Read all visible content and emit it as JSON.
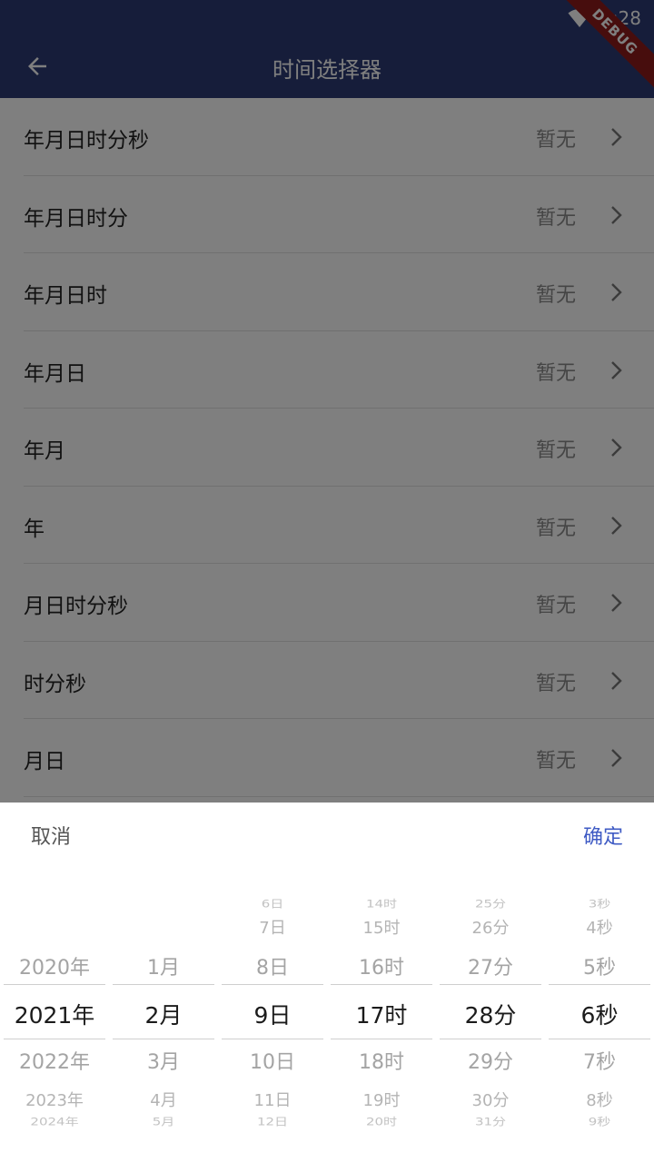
{
  "status_bar": {
    "time": "5:28",
    "debug_label": "DEBUG"
  },
  "app_bar": {
    "title": "时间选择器"
  },
  "list": {
    "items": [
      {
        "label": "年月日时分秒",
        "value": "暂无"
      },
      {
        "label": "年月日时分",
        "value": "暂无"
      },
      {
        "label": "年月日时",
        "value": "暂无"
      },
      {
        "label": "年月日",
        "value": "暂无"
      },
      {
        "label": "年月",
        "value": "暂无"
      },
      {
        "label": "年",
        "value": "暂无"
      },
      {
        "label": "月日时分秒",
        "value": "暂无"
      },
      {
        "label": "时分秒",
        "value": "暂无"
      },
      {
        "label": "月日",
        "value": "暂无"
      }
    ]
  },
  "picker": {
    "cancel_label": "取消",
    "confirm_label": "确定",
    "accent_color": "#3f5bc4",
    "columns": [
      {
        "name": "year",
        "items": [
          "2020年",
          "2021年",
          "2022年",
          "2023年",
          "2024年"
        ],
        "selected": 1
      },
      {
        "name": "month",
        "items": [
          "1月",
          "2月",
          "3月",
          "4月",
          "5月"
        ],
        "selected": 1
      },
      {
        "name": "day",
        "items": [
          "6日",
          "7日",
          "8日",
          "9日",
          "10日",
          "11日",
          "12日"
        ],
        "selected": 3
      },
      {
        "name": "hour",
        "items": [
          "14时",
          "15时",
          "16时",
          "17时",
          "18时",
          "19时",
          "20时"
        ],
        "selected": 3
      },
      {
        "name": "minute",
        "items": [
          "25分",
          "26分",
          "27分",
          "28分",
          "29分",
          "30分",
          "31分"
        ],
        "selected": 3
      },
      {
        "name": "second",
        "items": [
          "3秒",
          "4秒",
          "5秒",
          "6秒",
          "7秒",
          "8秒",
          "9秒"
        ],
        "selected": 3
      }
    ]
  }
}
